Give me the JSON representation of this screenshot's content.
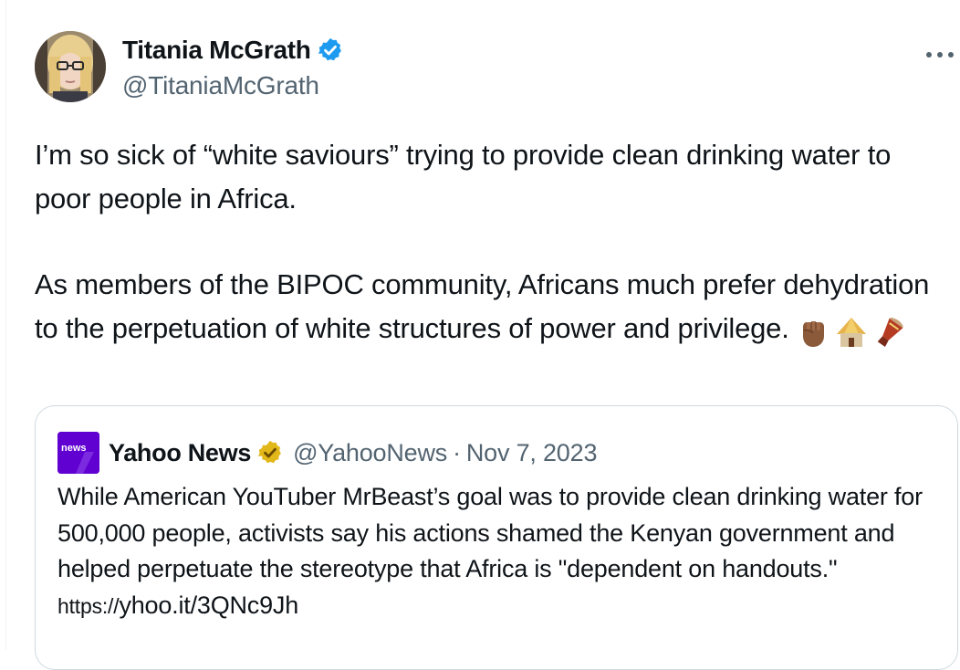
{
  "tweet": {
    "author": {
      "display_name": "Titania McGrath",
      "handle": "@TitaniaMcGrath",
      "verified": true,
      "badge_color": "#1d9bf0"
    },
    "paragraph_1": "I’m so sick of “white saviours” trying to provide clean drinking water to poor people in Africa.",
    "paragraph_2": "As members of the BIPOC community, Africans much prefer dehydration to the perpetuation of white structures of power and privilege.",
    "emojis": [
      "raised-fist-icon",
      "hut-icon",
      "drum-icon"
    ],
    "more_icon": "more-horizontal-icon"
  },
  "quote": {
    "logo_text": "news",
    "logo_color": "#6001d2",
    "display_name": "Yahoo News",
    "badge_color": "#e2b719",
    "handle": "@YahooNews",
    "separator": "·",
    "date": "Nov 7, 2023",
    "text": "While American YouTuber MrBeast’s goal was to provide clean drinking water for 500,000 people, activists say his actions shamed the Kenyan government and helped perpetuate the stereotype that Africa is \"dependent on handouts.\"",
    "link_prefix": "https://",
    "link_rest": "yhoo.it/3QNc9Jh"
  }
}
